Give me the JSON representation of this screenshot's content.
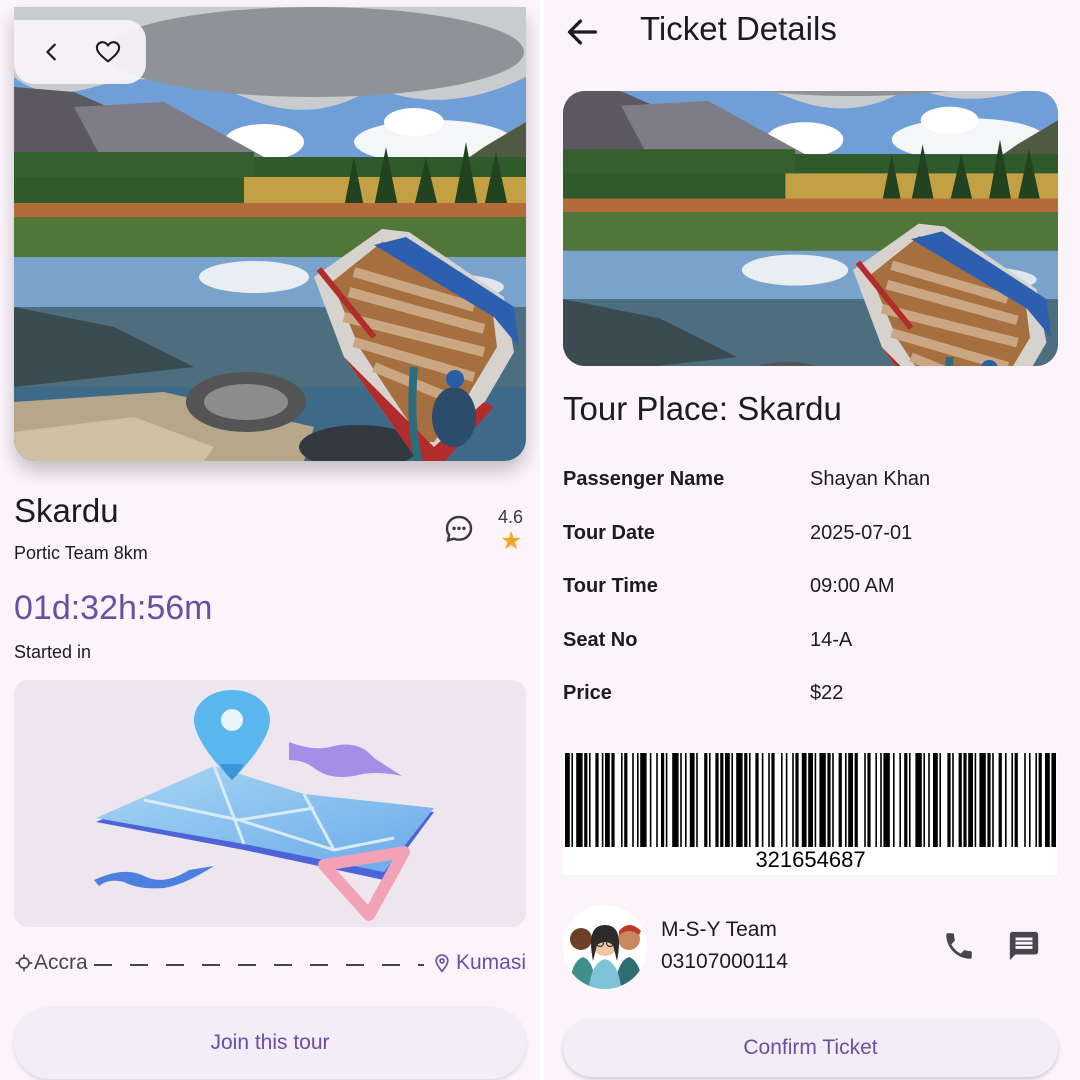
{
  "tour": {
    "title": "Skardu",
    "subtitle": "Portic Team 8km",
    "rating": "4.6",
    "rating_icon": "star-icon",
    "countdown": "01d:32h:56m",
    "started_label": "Started in",
    "route": {
      "from": "Accra",
      "to": "Kumasi"
    },
    "join_button": "Join this tour",
    "icons": [
      "back-icon",
      "heart-icon",
      "chat-bubble-icon",
      "map-pin-icon"
    ]
  },
  "ticket": {
    "header": "Ticket Details",
    "tour_place": "Tour Place: Skardu",
    "details": [
      {
        "label": "Passenger Name",
        "value": "Shayan Khan"
      },
      {
        "label": "Tour Date",
        "value": "2025-07-01"
      },
      {
        "label": "Tour Time",
        "value": "09:00 AM"
      },
      {
        "label": "Seat No",
        "value": "14-A"
      },
      {
        "label": "Price",
        "value": "$22"
      }
    ],
    "barcode_number": "321654687",
    "team": {
      "name": "M-S-Y Team",
      "phone": "03107000114"
    },
    "confirm_button": "Confirm Ticket",
    "icons": [
      "back-arrow-icon",
      "phone-icon",
      "message-icon"
    ]
  },
  "colors": {
    "background": "#fbf4fb",
    "accent": "#6750a4",
    "star": "#f5a623",
    "button_bg": "#f3edf7"
  }
}
